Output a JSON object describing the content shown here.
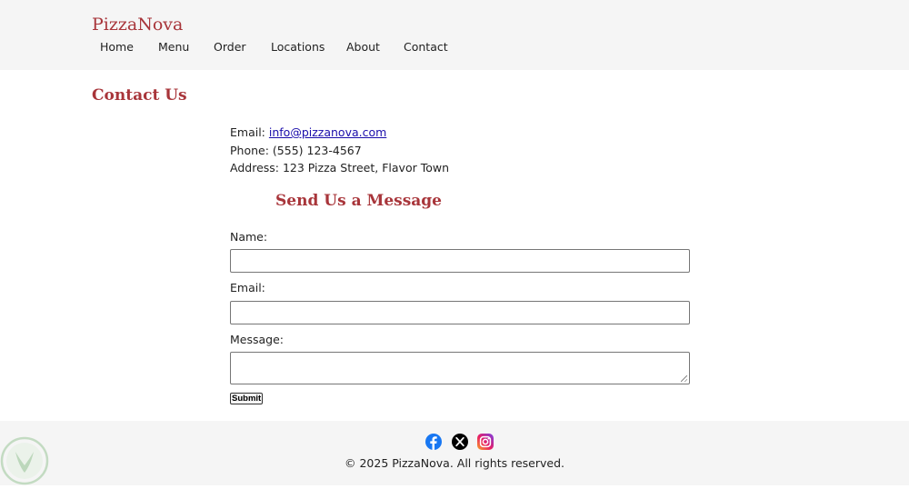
{
  "header": {
    "logo": "PizzaNova",
    "nav": [
      "Home",
      "Menu",
      "Order",
      "Locations",
      "About",
      "Contact"
    ]
  },
  "page": {
    "title": "Contact Us"
  },
  "contact_info": {
    "email_label": "Email: ",
    "email": "info@pizzanova.com",
    "phone": "Phone: (555) 123-4567",
    "address": "Address: 123 Pizza Street, Flavor Town"
  },
  "form": {
    "title": "Send Us a Message",
    "name_label": "Name:",
    "name_value": "",
    "email_label": "Email:",
    "email_value": "",
    "message_label": "Message:",
    "message_value": "",
    "submit_label": "Submit"
  },
  "footer": {
    "social_icons": [
      "facebook-icon",
      "x-icon",
      "instagram-icon"
    ],
    "copyright": "© 2025 PizzaNova. All rights reserved."
  },
  "colors": {
    "brand": "#a8353a",
    "header_bg": "#f5f5f5",
    "link": "#1a0dab",
    "facebook": "#1877f2"
  }
}
